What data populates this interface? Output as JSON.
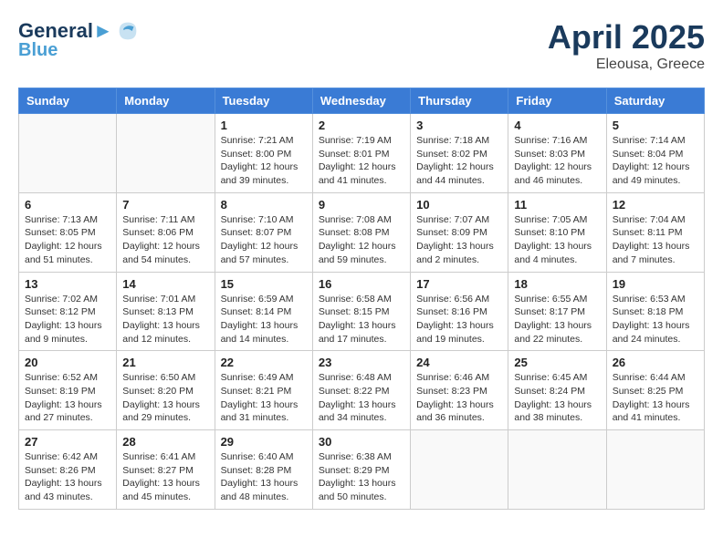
{
  "header": {
    "logo_line1": "General",
    "logo_line2": "Blue",
    "month": "April 2025",
    "location": "Eleousa, Greece"
  },
  "weekdays": [
    "Sunday",
    "Monday",
    "Tuesday",
    "Wednesday",
    "Thursday",
    "Friday",
    "Saturday"
  ],
  "weeks": [
    [
      {
        "day": "",
        "info": ""
      },
      {
        "day": "",
        "info": ""
      },
      {
        "day": "1",
        "info": "Sunrise: 7:21 AM\nSunset: 8:00 PM\nDaylight: 12 hours and 39 minutes."
      },
      {
        "day": "2",
        "info": "Sunrise: 7:19 AM\nSunset: 8:01 PM\nDaylight: 12 hours and 41 minutes."
      },
      {
        "day": "3",
        "info": "Sunrise: 7:18 AM\nSunset: 8:02 PM\nDaylight: 12 hours and 44 minutes."
      },
      {
        "day": "4",
        "info": "Sunrise: 7:16 AM\nSunset: 8:03 PM\nDaylight: 12 hours and 46 minutes."
      },
      {
        "day": "5",
        "info": "Sunrise: 7:14 AM\nSunset: 8:04 PM\nDaylight: 12 hours and 49 minutes."
      }
    ],
    [
      {
        "day": "6",
        "info": "Sunrise: 7:13 AM\nSunset: 8:05 PM\nDaylight: 12 hours and 51 minutes."
      },
      {
        "day": "7",
        "info": "Sunrise: 7:11 AM\nSunset: 8:06 PM\nDaylight: 12 hours and 54 minutes."
      },
      {
        "day": "8",
        "info": "Sunrise: 7:10 AM\nSunset: 8:07 PM\nDaylight: 12 hours and 57 minutes."
      },
      {
        "day": "9",
        "info": "Sunrise: 7:08 AM\nSunset: 8:08 PM\nDaylight: 12 hours and 59 minutes."
      },
      {
        "day": "10",
        "info": "Sunrise: 7:07 AM\nSunset: 8:09 PM\nDaylight: 13 hours and 2 minutes."
      },
      {
        "day": "11",
        "info": "Sunrise: 7:05 AM\nSunset: 8:10 PM\nDaylight: 13 hours and 4 minutes."
      },
      {
        "day": "12",
        "info": "Sunrise: 7:04 AM\nSunset: 8:11 PM\nDaylight: 13 hours and 7 minutes."
      }
    ],
    [
      {
        "day": "13",
        "info": "Sunrise: 7:02 AM\nSunset: 8:12 PM\nDaylight: 13 hours and 9 minutes."
      },
      {
        "day": "14",
        "info": "Sunrise: 7:01 AM\nSunset: 8:13 PM\nDaylight: 13 hours and 12 minutes."
      },
      {
        "day": "15",
        "info": "Sunrise: 6:59 AM\nSunset: 8:14 PM\nDaylight: 13 hours and 14 minutes."
      },
      {
        "day": "16",
        "info": "Sunrise: 6:58 AM\nSunset: 8:15 PM\nDaylight: 13 hours and 17 minutes."
      },
      {
        "day": "17",
        "info": "Sunrise: 6:56 AM\nSunset: 8:16 PM\nDaylight: 13 hours and 19 minutes."
      },
      {
        "day": "18",
        "info": "Sunrise: 6:55 AM\nSunset: 8:17 PM\nDaylight: 13 hours and 22 minutes."
      },
      {
        "day": "19",
        "info": "Sunrise: 6:53 AM\nSunset: 8:18 PM\nDaylight: 13 hours and 24 minutes."
      }
    ],
    [
      {
        "day": "20",
        "info": "Sunrise: 6:52 AM\nSunset: 8:19 PM\nDaylight: 13 hours and 27 minutes."
      },
      {
        "day": "21",
        "info": "Sunrise: 6:50 AM\nSunset: 8:20 PM\nDaylight: 13 hours and 29 minutes."
      },
      {
        "day": "22",
        "info": "Sunrise: 6:49 AM\nSunset: 8:21 PM\nDaylight: 13 hours and 31 minutes."
      },
      {
        "day": "23",
        "info": "Sunrise: 6:48 AM\nSunset: 8:22 PM\nDaylight: 13 hours and 34 minutes."
      },
      {
        "day": "24",
        "info": "Sunrise: 6:46 AM\nSunset: 8:23 PM\nDaylight: 13 hours and 36 minutes."
      },
      {
        "day": "25",
        "info": "Sunrise: 6:45 AM\nSunset: 8:24 PM\nDaylight: 13 hours and 38 minutes."
      },
      {
        "day": "26",
        "info": "Sunrise: 6:44 AM\nSunset: 8:25 PM\nDaylight: 13 hours and 41 minutes."
      }
    ],
    [
      {
        "day": "27",
        "info": "Sunrise: 6:42 AM\nSunset: 8:26 PM\nDaylight: 13 hours and 43 minutes."
      },
      {
        "day": "28",
        "info": "Sunrise: 6:41 AM\nSunset: 8:27 PM\nDaylight: 13 hours and 45 minutes."
      },
      {
        "day": "29",
        "info": "Sunrise: 6:40 AM\nSunset: 8:28 PM\nDaylight: 13 hours and 48 minutes."
      },
      {
        "day": "30",
        "info": "Sunrise: 6:38 AM\nSunset: 8:29 PM\nDaylight: 13 hours and 50 minutes."
      },
      {
        "day": "",
        "info": ""
      },
      {
        "day": "",
        "info": ""
      },
      {
        "day": "",
        "info": ""
      }
    ]
  ]
}
